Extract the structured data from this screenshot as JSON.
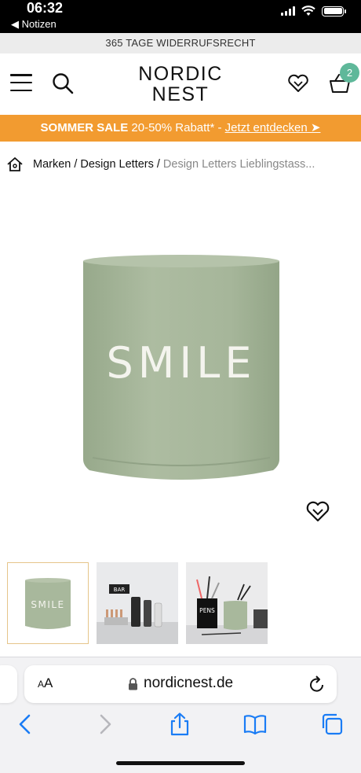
{
  "status": {
    "time": "06:32",
    "back_label": "◀ Notizen"
  },
  "notice": {
    "text": "365 TAGE WIDERRUFSRECHT"
  },
  "header": {
    "logo_line1": "NORDIC",
    "logo_line2": "NEST",
    "cart_count": "2",
    "accent_color": "#5fb89a"
  },
  "sale": {
    "bold": "SOMMER SALE",
    "text": " 20-50% Rabatt* - ",
    "link": "Jetzt entdecken ➤",
    "color": "#f29b30"
  },
  "breadcrumb": {
    "items": [
      "Marken",
      "Design Letters"
    ],
    "current": "Design Letters Lieblingstass..."
  },
  "product": {
    "cup_text": "SMILE",
    "cup_color": "#a8b89c",
    "thumbnails": [
      {
        "label": "SMILE",
        "icon": "cup-thumbnail"
      },
      {
        "label": "BAR",
        "icon": "bar-scene-thumbnail"
      },
      {
        "label": "PENS",
        "icon": "pens-scene-thumbnail"
      }
    ]
  },
  "safari": {
    "text_size_label_small": "A",
    "text_size_label_large": "A",
    "url": "nordicnest.de"
  }
}
